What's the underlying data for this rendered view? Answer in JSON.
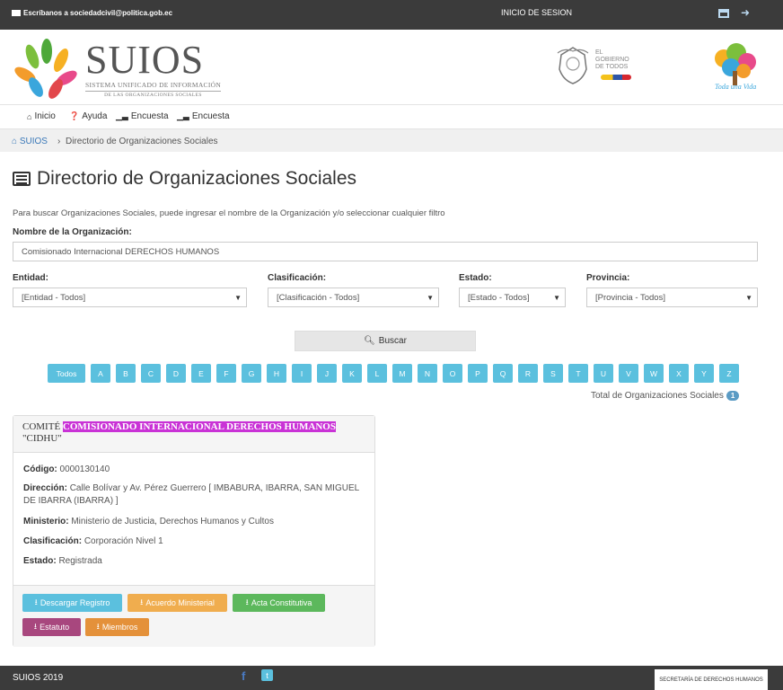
{
  "topbar": {
    "email": "Escríbanos a sociedadcivil@politica.gob.ec",
    "login": "INICIO DE SESION"
  },
  "header": {
    "brand": "SUIOS",
    "subtitle": "SISTEMA UNIFICADO DE INFORMACIÓN",
    "subtitle2": "DE LAS ORGANIZACIONES SOCIALES",
    "gob_line1": "EL",
    "gob_line2": "GOBIERNO",
    "gob_line3": "DE TODOS",
    "tree_logo": "Toda una Vida"
  },
  "nav": {
    "items": [
      {
        "label": "Inicio",
        "icon": "home-icon"
      },
      {
        "label": "Ayuda",
        "icon": "question-icon"
      },
      {
        "label": "Encuesta",
        "icon": "bar-chart-icon"
      },
      {
        "label": "Encuesta",
        "icon": "bar-chart-icon"
      }
    ]
  },
  "breadcrumb": {
    "home": "SUIOS",
    "current": "Directorio de Organizaciones Sociales"
  },
  "page": {
    "title": "Directorio de Organizaciones Sociales",
    "help": "Para buscar Organizaciones Sociales, puede ingresar el nombre de la Organización y/o seleccionar cualquier filtro"
  },
  "form": {
    "name_label": "Nombre de la Organización:",
    "name_value": "Comisionado Internacional DERECHOS HUMANOS",
    "entidad_label": "Entidad:",
    "entidad_value": "[Entidad - Todos]",
    "clasif_label": "Clasificación:",
    "clasif_value": "[Clasificación - Todos]",
    "estado_label": "Estado:",
    "estado_value": "[Estado - Todos]",
    "provincia_label": "Provincia:",
    "provincia_value": "[Provincia - Todos]",
    "search_button": "Buscar"
  },
  "letters": [
    "Todos",
    "A",
    "B",
    "C",
    "D",
    "E",
    "F",
    "G",
    "H",
    "I",
    "J",
    "K",
    "L",
    "M",
    "N",
    "O",
    "P",
    "Q",
    "R",
    "S",
    "T",
    "U",
    "V",
    "W",
    "X",
    "Y",
    "Z"
  ],
  "total": {
    "label": "Total de Organizaciones Sociales",
    "count": "1"
  },
  "card": {
    "prefix": "COMITÉ",
    "highlight": "COMISIONADO INTERNACIONAL DERECHOS HUMANOS",
    "suffix": "\"CIDHU\"",
    "codigo_label": "Código:",
    "codigo": "0000130140",
    "direccion_label": "Dirección:",
    "direccion": "Calle Bolívar y Av. Pérez Guerrero [ IMBABURA, IBARRA, SAN MIGUEL DE IBARRA (IBARRA) ]",
    "ministerio_label": "Ministerio:",
    "ministerio": "Ministerio de Justicia, Derechos Humanos y Cultos",
    "clasificacion_label": "Clasificación:",
    "clasificacion": "Corporación Nivel 1",
    "estado_label": "Estado:",
    "estado": "Registrada",
    "buttons": {
      "descargar": "Descargar Registro",
      "acuerdo": "Acuerdo Ministerial",
      "acta": "Acta Constitutiva",
      "estatuto": "Estatuto",
      "miembros": "Miembros"
    }
  },
  "footer": {
    "year": "SUIOS 2019",
    "secretaria": "SECRETARÍA DE DERECHOS HUMANOS"
  },
  "colors": {
    "info": "#5bc0de",
    "warning": "#f0ad4e",
    "success": "#5cb85c",
    "estatuto": "#a8477e",
    "miembros": "#e4913a",
    "highlight": "#c932d6",
    "dark": "#3b3b3b"
  }
}
